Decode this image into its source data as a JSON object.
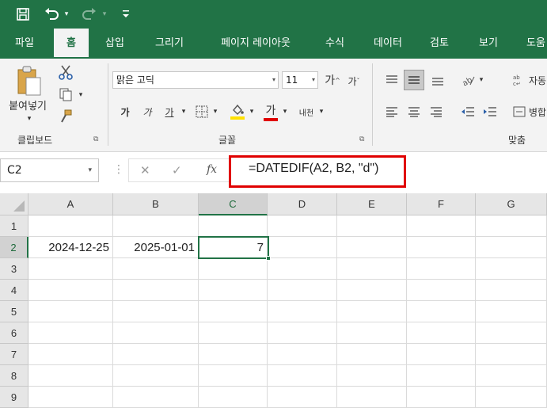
{
  "qat": {
    "save_icon": "save-icon",
    "undo_icon": "undo-icon",
    "redo_icon": "redo-icon",
    "customize_icon": "customize-qat-icon"
  },
  "tabs": [
    {
      "label": "파일"
    },
    {
      "label": "홈"
    },
    {
      "label": "삽입"
    },
    {
      "label": "그리기"
    },
    {
      "label": "페이지 레이아웃"
    },
    {
      "label": "수식"
    },
    {
      "label": "데이터"
    },
    {
      "label": "검토"
    },
    {
      "label": "보기"
    },
    {
      "label": "도움"
    }
  ],
  "ribbon": {
    "clipboard": {
      "paste_label": "붙여넣기",
      "group_label": "클립보드"
    },
    "font": {
      "font_name": "맑은 고딕",
      "font_size": "11",
      "bold": "가",
      "italic": "가",
      "underline": "가",
      "font_color_letter": "가",
      "phonetic": "내천",
      "increase": "가",
      "decrease": "가",
      "group_label": "글꼴"
    },
    "alignment": {
      "wrap_label": "자동",
      "merge_label": "병합",
      "group_label": "맞춤"
    },
    "colors": {
      "ribbon_green": "#217346",
      "highlight_yellow": "#ffe100",
      "font_red": "#e00000"
    }
  },
  "formula_bar": {
    "name_box": "C2",
    "cancel": "✕",
    "enter": "✓",
    "fx": "fx",
    "formula": "=DATEDIF(A2, B2, \"d\")"
  },
  "sheet": {
    "columns": [
      "A",
      "B",
      "C",
      "D",
      "E",
      "F",
      "G"
    ],
    "rows": [
      "1",
      "2",
      "3",
      "4",
      "5",
      "6",
      "7",
      "8",
      "9"
    ],
    "cells": {
      "A2": "2024-12-25",
      "B2": "2025-01-01",
      "C2": "7"
    }
  }
}
